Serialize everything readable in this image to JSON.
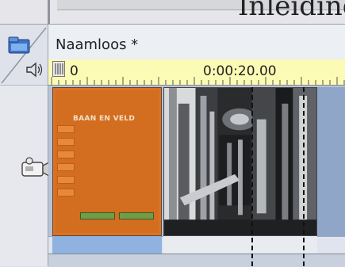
{
  "cut_off_heading": "Inleiding",
  "timeline": {
    "project_title": "Naamloos *",
    "ruler": {
      "start_label": "0",
      "mid_label": "0:00:20.00"
    }
  },
  "clips": {
    "title_card": {
      "label": "BAAN EN VELD"
    }
  },
  "icons": {
    "folder": "folder-icon",
    "speaker": "speaker-icon",
    "camera": "video-camera-icon",
    "playhead": "playhead-grip-icon"
  },
  "colors": {
    "ruler_background": "#fcfbb5",
    "title_clip": "#db7223",
    "track_background": "#b7c3d6"
  }
}
